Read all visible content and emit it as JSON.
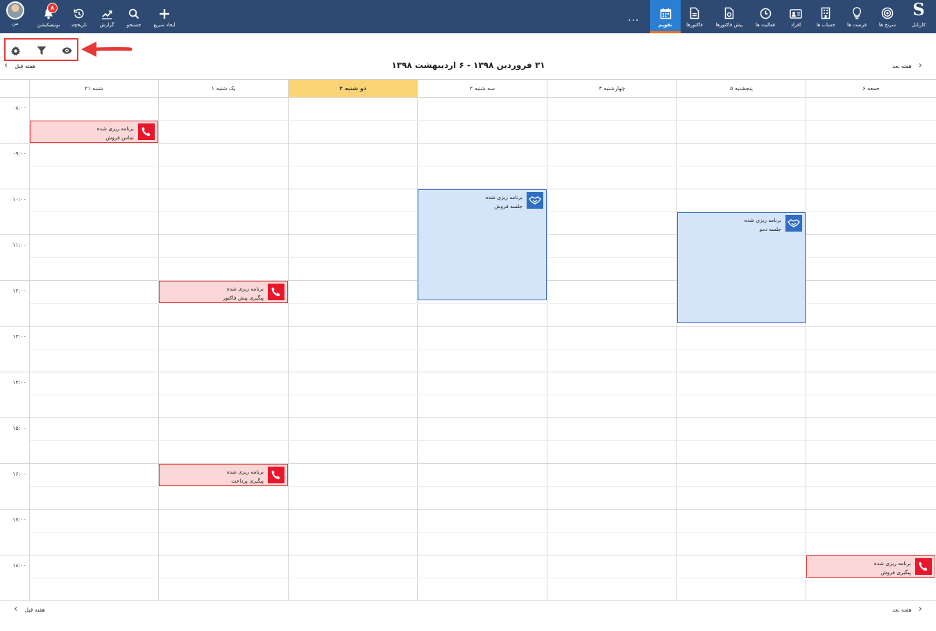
{
  "topbar": {
    "logo": "S",
    "nav_right": [
      {
        "label": "کارتابل",
        "icon": "logo-s-icon"
      },
      {
        "label": "سرنخ ها",
        "icon": "target-icon"
      },
      {
        "label": "فرصت ها",
        "icon": "lightbulb-icon"
      },
      {
        "label": "حساب ها",
        "icon": "building-icon"
      },
      {
        "label": "افراد",
        "icon": "contact-card-icon"
      },
      {
        "label": "فعالیت ها",
        "icon": "clock-icon"
      },
      {
        "label": "پیش فاکتورها",
        "icon": "quote-file-icon"
      },
      {
        "label": "فاکتورها",
        "icon": "invoice-file-icon"
      },
      {
        "label": "تقویم",
        "icon": "calendar-icon",
        "active": true
      }
    ],
    "more": "...",
    "nav_left": [
      {
        "label": "ایجاد سریع",
        "icon": "plus-icon"
      },
      {
        "label": "جستجو",
        "icon": "search-icon"
      },
      {
        "label": "گزارش",
        "icon": "chart-icon"
      },
      {
        "label": "تاریخچه",
        "icon": "history-icon"
      },
      {
        "label": "نوتیفیکیشن",
        "icon": "bell-icon",
        "badge": "۸"
      },
      {
        "label": "من",
        "icon": "avatar"
      }
    ]
  },
  "toolbar": {
    "tools": [
      "settings-icon",
      "filter-icon",
      "eye-icon"
    ]
  },
  "calendar": {
    "title": "۳۱ فروردین ۱۳۹۸ - ۶ اردیبهشت ۱۳۹۸",
    "next_week": "هفته بعد",
    "prev_week": "هفته قبل",
    "days": [
      {
        "label": "جمعه ۶"
      },
      {
        "label": "پنجشنبه ۵"
      },
      {
        "label": "چهارشنبه ۴"
      },
      {
        "label": "سه شنبه ۳"
      },
      {
        "label": "دو شنبه ۲",
        "today": true
      },
      {
        "label": "یک شنبه ۱"
      },
      {
        "label": "شنبه ۳۱"
      }
    ],
    "times": [
      "۰۸:۰۰",
      "۰۹:۰۰",
      "۱۰:۰۰",
      "۱۱:۰۰",
      "۱۲:۰۰",
      "۱۳:۰۰",
      "۱۴:۰۰",
      "۱۵:۰۰",
      "۱۶:۰۰",
      "۱۷:۰۰",
      "۱۸:۰۰"
    ],
    "events": [
      {
        "type": "call",
        "status": "برنامه ریزی شده",
        "title": "تماس فروش",
        "day": "شنبه ۳۱",
        "start": "۰۸:۳۰",
        "end": "۰۹:۰۰"
      },
      {
        "type": "call",
        "status": "برنامه ریزی شده",
        "title": "پیگیری پیش فاکتور",
        "day": "یک شنبه ۱",
        "start": "۱۲:۰۰",
        "end": "۱۲:۳۰"
      },
      {
        "type": "call",
        "status": "برنامه ریزی شده",
        "title": "پیگیری پرداخت",
        "day": "یک شنبه ۱",
        "start": "۱۶:۰۰",
        "end": "۱۶:۳۰"
      },
      {
        "type": "meeting",
        "status": "برنامه ریزی شده",
        "title": "جلسه فروش",
        "day": "سه شنبه ۳",
        "start": "۱۰:۰۰",
        "end": "۱۲:۳۰"
      },
      {
        "type": "meeting",
        "status": "برنامه ریزی شده",
        "title": "جلسه دمو",
        "day": "پنجشنبه ۵",
        "start": "۱۰:۳۰",
        "end": "۱۳:۰۰"
      },
      {
        "type": "call",
        "status": "برنامه ریزی شده",
        "title": "پیگیری فروش",
        "day": "جمعه ۶",
        "start": "۱۸:۰۰",
        "end": "۱۸:۳۰"
      }
    ]
  }
}
